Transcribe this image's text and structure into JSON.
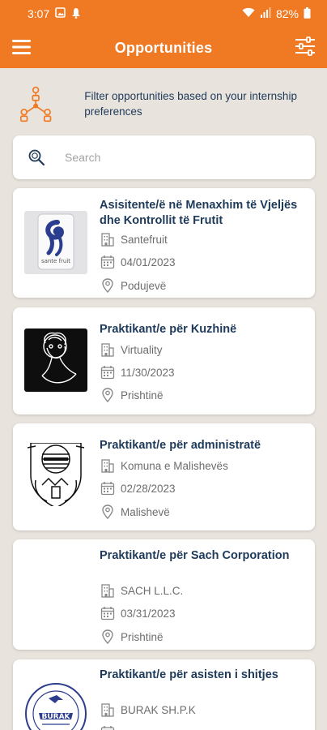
{
  "status_bar": {
    "time": "3:07",
    "battery": "82%"
  },
  "app_bar": {
    "title": "Opportunities"
  },
  "filter_hint": {
    "text": "Filter opportunities based on your internship preferences"
  },
  "search": {
    "placeholder": "Search",
    "value": ""
  },
  "accent_color": "#f07a23",
  "text_color": "#1e3a5a",
  "opportunities": [
    {
      "title": "Asisitente/ë në Menaxhim të Vjeljës dhe Kontrollit të Frutit",
      "company": "Santefruit",
      "date": "04/01/2023",
      "location": "Podujevë",
      "logo_text": "sante fruit"
    },
    {
      "title": "Praktikant/e për Kuzhinë",
      "company": "Virtuality",
      "date": "11/30/2023",
      "location": "Prishtinë"
    },
    {
      "title": "Praktikant/e për administratë",
      "company": "Komuna e Malishevës",
      "date": "02/28/2023",
      "location": "Malishevë"
    },
    {
      "title": "Praktikant/e për Sach Corporation",
      "company": "SACH L.L.C.",
      "date": "03/31/2023",
      "location": "Prishtinë"
    },
    {
      "title": "Praktikant/e për asisten i shitjes",
      "company": "BURAK SH.P.K",
      "logo_text": "BURAK"
    }
  ]
}
